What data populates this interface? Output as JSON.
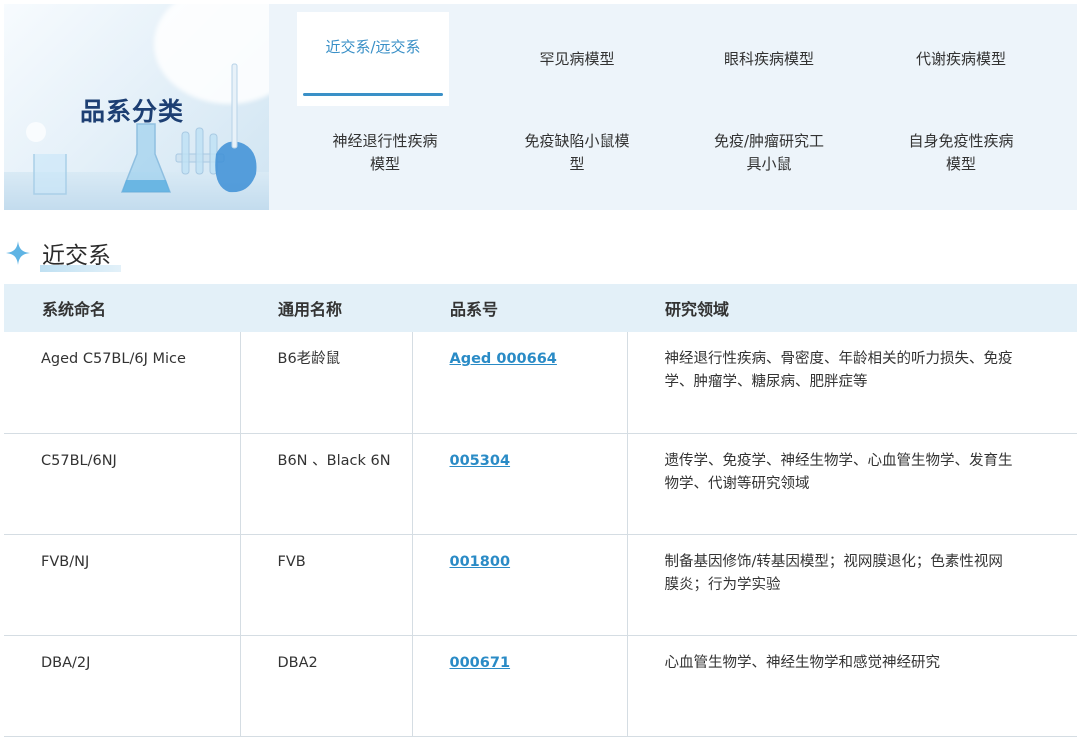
{
  "banner": {
    "title": "品系分类"
  },
  "tabs": [
    {
      "label": "近交系/远交系",
      "active": true
    },
    {
      "label": "罕见病模型",
      "active": false
    },
    {
      "label": "眼科疾病模型",
      "active": false
    },
    {
      "label": "代谢疾病模型",
      "active": false
    },
    {
      "label": "神经退行性疾病模型",
      "active": false
    },
    {
      "label": "免疫缺陷小鼠模型",
      "active": false
    },
    {
      "label": "免疫/肿瘤研究工具小鼠",
      "active": false
    },
    {
      "label": "自身免疫性疾病模型",
      "active": false
    }
  ],
  "section": {
    "title": "近交系",
    "icon": "sparkle-icon"
  },
  "table": {
    "headers": [
      "系统命名",
      "通用名称",
      "品系号",
      "研究领域"
    ],
    "rows": [
      {
        "system_name": "Aged C57BL/6J Mice",
        "common_name": "B6老龄鼠",
        "strain_no": "Aged 000664",
        "research": "神经退行性疾病、骨密度、年龄相关的听力损失、免疫学、肿瘤学、糖尿病、肥胖症等"
      },
      {
        "system_name": "C57BL/6NJ",
        "common_name": "B6N 、Black 6N",
        "strain_no": "005304",
        "research": "遗传学、免疫学、神经生物学、心血管生物学、发育生物学、代谢等研究领域"
      },
      {
        "system_name": "FVB/NJ",
        "common_name": "FVB",
        "strain_no": "001800",
        "research": "制备基因修饰/转基因模型；视网膜退化；色素性视网膜炎；行为学实验"
      },
      {
        "system_name": "DBA/2J",
        "common_name": "DBA2",
        "strain_no": "000671",
        "research": "心血管生物学、神经生物学和感觉神经研究"
      }
    ]
  },
  "colors": {
    "accent": "#3a90c7",
    "link": "#2a8bc6",
    "panel_bg": "#edf4fa",
    "header_bg": "#e3f0f8",
    "title_dark": "#1d3f73"
  }
}
